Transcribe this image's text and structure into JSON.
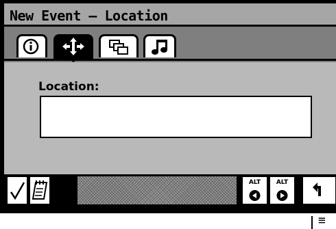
{
  "window": {
    "title": "New Event – Location"
  },
  "tabs": [
    {
      "name": "info",
      "icon": "info-icon",
      "selected": false
    },
    {
      "name": "location",
      "icon": "move-arrows-icon",
      "selected": true
    },
    {
      "name": "windows",
      "icon": "windows-icon",
      "selected": false
    },
    {
      "name": "music",
      "icon": "music-note-icon",
      "selected": false
    }
  ],
  "location": {
    "label": "Location:",
    "value": ""
  },
  "toolbar": {
    "done_icon": "checkmark-icon",
    "notes_icon": "notepad-icon",
    "alt_left_label": "ALT",
    "alt_right_label": "ALT",
    "back_icon": "return-arrow-icon"
  },
  "status": {
    "icon": "menu-lines-icon"
  }
}
